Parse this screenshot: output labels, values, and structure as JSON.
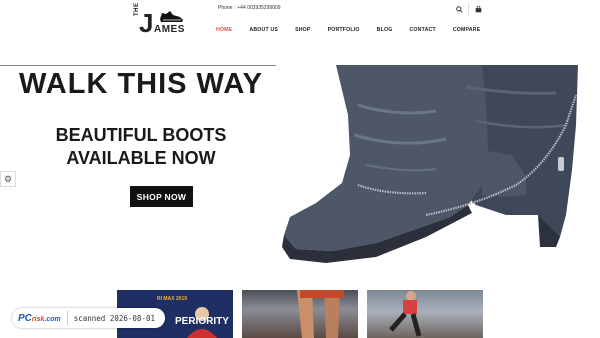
{
  "header": {
    "logo_top": "THE",
    "logo_j": "J",
    "logo_rest": "AMES",
    "phone_label": "Phone :",
    "phone_number": "+44 003935299009",
    "icons": [
      "search-icon",
      "cart-icon"
    ]
  },
  "nav": {
    "items": [
      {
        "label": "HOME",
        "active": true
      },
      {
        "label": "ABOUT US",
        "active": false
      },
      {
        "label": "SHOP",
        "active": false
      },
      {
        "label": "PORTFOLIO",
        "active": false
      },
      {
        "label": "BLOG",
        "active": false
      },
      {
        "label": "CONTACT",
        "active": false
      },
      {
        "label": "COMPARE",
        "active": false
      }
    ]
  },
  "hero": {
    "title": "WALK THIS WAY",
    "subtitle_line1": "BEAUTIFUL BOOTS",
    "subtitle_line2": "AVAILABLE NOW",
    "button_label": "SHOP NOW"
  },
  "thumbnails": {
    "first_small_text": "RI MAX 2019",
    "first_big_text": "PERIORITY"
  },
  "watermark": {
    "brand": "PC",
    "brand_rest": "risk",
    "brand_suffix": ".com",
    "scan_text": "scanned 2026-08-01"
  },
  "colors": {
    "accent": "#e74c3c",
    "button_bg": "#111111",
    "boot": "#4a5363"
  }
}
